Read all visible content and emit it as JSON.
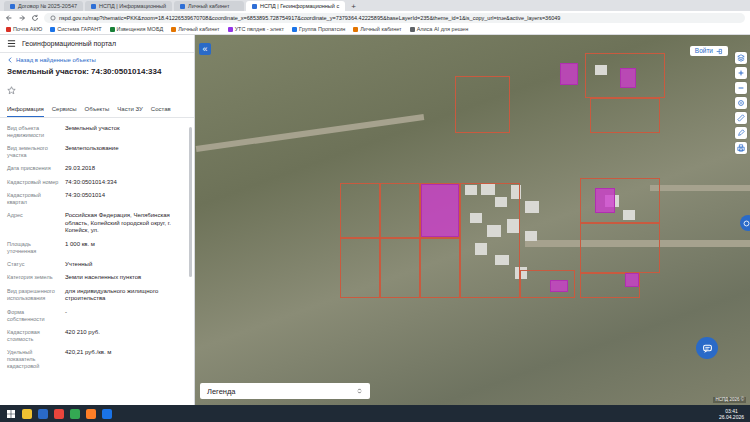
{
  "browser": {
    "tabs": [
      {
        "label": "Договор № 2025-20547",
        "selected": false
      },
      {
        "label": "НСПД | Информационный",
        "selected": false
      },
      {
        "label": "Личный кабинет",
        "selected": false
      },
      {
        "label": "НСПД | Геоинформационный с",
        "selected": true
      }
    ],
    "new_tab": "+",
    "address": "nspd.gov.ru/map?thematic=PKK&zoom=18.41226539670708&coordinate_x=6853895.728754917&coordinate_y=7379364.42225895&baseLayerId=235&theme_id=1&is_copy_url=true&active_layers=36049",
    "bookmarks": [
      "Почта АКЮ",
      "Система ГАРАНТ",
      "Извещения МОБД",
      "Личный кабинет",
      "УТС пвлдев - элект",
      "Группа Пропатсин",
      "Личный кабинет",
      "Алиса AI для решен"
    ]
  },
  "portal": {
    "title": "Геоинформационный портал",
    "collapse": "«",
    "login": "Войти"
  },
  "card": {
    "back": "Назад в найденные объекты",
    "title": "Земельный участок: 74:30:0501014:334",
    "tabs": [
      {
        "label": "Информация",
        "selected": true
      },
      {
        "label": "Сервисы",
        "selected": false
      },
      {
        "label": "Объекты",
        "selected": false
      },
      {
        "label": "Части ЗУ",
        "selected": false
      },
      {
        "label": "Состав",
        "selected": false
      }
    ],
    "fields": [
      {
        "label": "Вид объекта недвижимости",
        "value": "Земельный участок"
      },
      {
        "label": "Вид земельного участка",
        "value": "Землепользование"
      },
      {
        "label": "Дата присвоения",
        "value": "29.03.2018"
      },
      {
        "label": "Кадастровый номер",
        "value": "74:30:0501014:334"
      },
      {
        "label": "Кадастровый квартал",
        "value": "74:30:0501014"
      },
      {
        "label": "Адрес",
        "value": "Российская Федерация, Челябинская область, Копейский городской округ, г. Копейск, ул."
      },
      {
        "label": "Площадь уточненная",
        "value": "1 000 кв. м"
      },
      {
        "label": "Статус",
        "value": "Учтенный"
      },
      {
        "label": "Категория земель",
        "value": "Земли населенных пунктов"
      },
      {
        "label": "Вид разрешенного использования",
        "value": "для индивидуального жилищного строительства"
      },
      {
        "label": "Форма собственности",
        "value": "-"
      },
      {
        "label": "Кадастровая стоимость",
        "value": "420 210 руб."
      },
      {
        "label": "Удельный показатель кадастровой",
        "value": "420,21 руб./кв. м"
      }
    ]
  },
  "legend": {
    "label": "Легенда"
  },
  "attribution": "НСПД 2026 ©",
  "taskbar": {
    "time": "03:41",
    "date": "26.04.2026"
  }
}
